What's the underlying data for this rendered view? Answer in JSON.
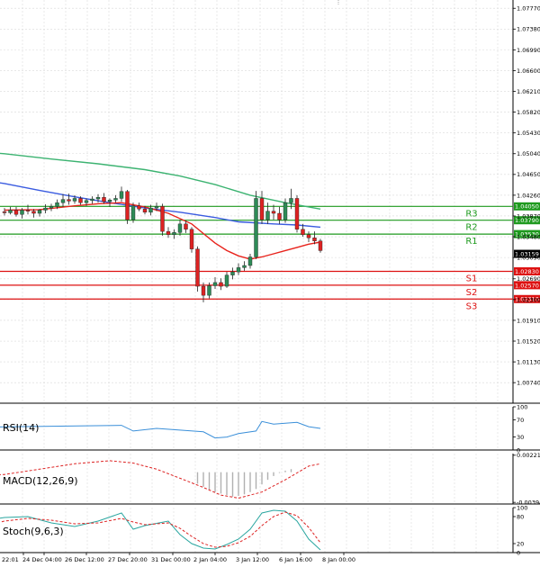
{
  "colors": {
    "bull": "#2e8b57",
    "bear": "#dd2222",
    "resistance": "#1e9a1e",
    "support": "#dd1111",
    "ma_fast": "#e8231c",
    "ma_mid": "#3b5ce0",
    "ma_slow": "#3cb371",
    "grid": "#d9d9d9",
    "rsi": "#3a8fd9",
    "macd_hist": "#b0b0b0",
    "macd_signal": "#dd2222",
    "stoch_k": "#2aa6a0",
    "stoch_d": "#dd2222"
  },
  "chart_data": [
    {
      "type": "candlestick",
      "panel": "price",
      "y_ticks": [
        "1.07770",
        "1.07380",
        "1.06990",
        "1.06600",
        "1.06210",
        "1.05820",
        "1.05430",
        "1.05040",
        "1.04650",
        "1.04260",
        "1.03870",
        "1.03480",
        "1.03090",
        "1.02690",
        "1.02300",
        "1.01910",
        "1.01520",
        "1.01130",
        "1.00740"
      ],
      "ylim": [
        1.00354,
        1.07926
      ],
      "x_labels": [
        "22:01",
        "24 Dec 04:00",
        "26 Dec 12:00",
        "27 Dec 20:00",
        "31 Dec 00:00",
        "2 Jan 04:00",
        "3 Jan 12:00",
        "6 Jan 16:00",
        "8 Jan 00:00"
      ],
      "candles": [
        [
          1.0395,
          1.0402,
          1.0388,
          1.0393
        ],
        [
          1.0393,
          1.0404,
          1.039,
          1.0398
        ],
        [
          1.0398,
          1.0404,
          1.0386,
          1.039
        ],
        [
          1.039,
          1.0402,
          1.0382,
          1.0398
        ],
        [
          1.0398,
          1.0408,
          1.039,
          1.0396
        ],
        [
          1.0396,
          1.04,
          1.0384,
          1.0392
        ],
        [
          1.0392,
          1.04,
          1.0386,
          1.0398
        ],
        [
          1.0398,
          1.0409,
          1.0392,
          1.0402
        ],
        [
          1.0402,
          1.041,
          1.0396,
          1.0405
        ],
        [
          1.0405,
          1.0418,
          1.04,
          1.0412
        ],
        [
          1.0412,
          1.0428,
          1.0404,
          1.0418
        ],
        [
          1.0418,
          1.0429,
          1.0408,
          1.0415
        ],
        [
          1.0415,
          1.0426,
          1.041,
          1.042
        ],
        [
          1.042,
          1.0424,
          1.0408,
          1.0412
        ],
        [
          1.0412,
          1.042,
          1.0406,
          1.0416
        ],
        [
          1.0416,
          1.0424,
          1.041,
          1.0419
        ],
        [
          1.0419,
          1.0428,
          1.0412,
          1.0422
        ],
        [
          1.0422,
          1.043,
          1.041,
          1.0414
        ],
        [
          1.0414,
          1.042,
          1.0404,
          1.0417
        ],
        [
          1.0417,
          1.0426,
          1.0412,
          1.042
        ],
        [
          1.042,
          1.0442,
          1.0414,
          1.0433
        ],
        [
          1.0433,
          1.0436,
          1.0372,
          1.038
        ],
        [
          1.038,
          1.0412,
          1.0374,
          1.0406
        ],
        [
          1.0406,
          1.0412,
          1.0396,
          1.04
        ],
        [
          1.04,
          1.0406,
          1.039,
          1.0394
        ],
        [
          1.0394,
          1.0408,
          1.0388,
          1.0402
        ],
        [
          1.0402,
          1.0412,
          1.0396,
          1.0405
        ],
        [
          1.0405,
          1.041,
          1.035,
          1.0358
        ],
        [
          1.0358,
          1.0366,
          1.0346,
          1.0352
        ],
        [
          1.0352,
          1.0362,
          1.0344,
          1.0356
        ],
        [
          1.0356,
          1.038,
          1.035,
          1.0372
        ],
        [
          1.0372,
          1.0378,
          1.0355,
          1.0362
        ],
        [
          1.0362,
          1.0366,
          1.0318,
          1.0325
        ],
        [
          1.0325,
          1.033,
          1.0245,
          1.0255
        ],
        [
          1.0255,
          1.0262,
          1.0225,
          1.0238
        ],
        [
          1.0238,
          1.0262,
          1.0232,
          1.0256
        ],
        [
          1.0256,
          1.0272,
          1.025,
          1.0262
        ],
        [
          1.0262,
          1.027,
          1.0248,
          1.0255
        ],
        [
          1.0255,
          1.0282,
          1.0252,
          1.0276
        ],
        [
          1.0276,
          1.029,
          1.0268,
          1.0282
        ],
        [
          1.0282,
          1.0298,
          1.0276,
          1.029
        ],
        [
          1.029,
          1.0302,
          1.0284,
          1.0294
        ],
        [
          1.0294,
          1.0316,
          1.0288,
          1.031
        ],
        [
          1.031,
          1.0434,
          1.0306,
          1.042
        ],
        [
          1.042,
          1.0434,
          1.0372,
          1.038
        ],
        [
          1.038,
          1.0412,
          1.0372,
          1.0396
        ],
        [
          1.0396,
          1.0408,
          1.038,
          1.0392
        ],
        [
          1.0392,
          1.0404,
          1.0372,
          1.038
        ],
        [
          1.038,
          1.042,
          1.0374,
          1.0412
        ],
        [
          1.0412,
          1.0438,
          1.04,
          1.042
        ],
        [
          1.042,
          1.0426,
          1.0356,
          1.0362
        ],
        [
          1.0362,
          1.0372,
          1.0348,
          1.0352
        ],
        [
          1.0352,
          1.0358,
          1.0338,
          1.0346
        ],
        [
          1.0346,
          1.0358,
          1.0334,
          1.034
        ],
        [
          1.034,
          1.0344,
          1.0318,
          1.0322
        ]
      ],
      "ma_fast": [
        [
          0,
          1.0398
        ],
        [
          6,
          1.0399
        ],
        [
          12,
          1.0406
        ],
        [
          16,
          1.041
        ],
        [
          20,
          1.0412
        ],
        [
          24,
          1.0404
        ],
        [
          28,
          1.0392
        ],
        [
          32,
          1.0372
        ],
        [
          34,
          1.0354
        ],
        [
          36,
          1.0336
        ],
        [
          38,
          1.0322
        ],
        [
          40,
          1.0312
        ],
        [
          42,
          1.0306
        ],
        [
          44,
          1.031
        ],
        [
          46,
          1.0316
        ],
        [
          48,
          1.0322
        ],
        [
          50,
          1.0328
        ],
        [
          52,
          1.0334
        ],
        [
          54,
          1.0338
        ]
      ],
      "ma_mid": [
        [
          -8,
          1.046
        ],
        [
          0,
          1.0448
        ],
        [
          6,
          1.0435
        ],
        [
          12,
          1.0423
        ],
        [
          18,
          1.0412
        ],
        [
          24,
          1.0402
        ],
        [
          30,
          1.0394
        ],
        [
          36,
          1.0384
        ],
        [
          40,
          1.0376
        ],
        [
          46,
          1.0372
        ],
        [
          50,
          1.037
        ],
        [
          54,
          1.0366
        ]
      ],
      "ma_slow": [
        [
          -8,
          1.051
        ],
        [
          0,
          1.0504
        ],
        [
          8,
          1.0494
        ],
        [
          16,
          1.0485
        ],
        [
          24,
          1.0474
        ],
        [
          30,
          1.0462
        ],
        [
          36,
          1.0446
        ],
        [
          42,
          1.0426
        ],
        [
          48,
          1.0412
        ],
        [
          54,
          1.04
        ]
      ],
      "levels": [
        {
          "name": "R3",
          "value": 1.0405,
          "label": "1.04050",
          "kind": "resistance"
        },
        {
          "name": "R2",
          "value": 1.0379,
          "label": "1.03790",
          "kind": "resistance"
        },
        {
          "name": "R1",
          "value": 1.0353,
          "label": "1.03530",
          "kind": "resistance"
        },
        {
          "name": "S1",
          "value": 1.0283,
          "label": "1.02830",
          "kind": "support"
        },
        {
          "name": "S2",
          "value": 1.0257,
          "label": "1.02570",
          "kind": "support"
        },
        {
          "name": "S3",
          "value": 1.0231,
          "label": "1.02310",
          "kind": "support"
        }
      ],
      "current_price": {
        "value": 1.03159,
        "label": "1.03159"
      }
    },
    {
      "type": "line",
      "panel": "rsi",
      "title": "RSI(14)",
      "y_ticks": [
        "100",
        "70",
        "30",
        "0"
      ],
      "ylim": [
        0,
        100
      ],
      "values": [
        [
          -8,
          52
        ],
        [
          2,
          54
        ],
        [
          8,
          55
        ],
        [
          14,
          56
        ],
        [
          20,
          57
        ],
        [
          22,
          44
        ],
        [
          26,
          50
        ],
        [
          30,
          46
        ],
        [
          34,
          42
        ],
        [
          36,
          28
        ],
        [
          38,
          30
        ],
        [
          40,
          38
        ],
        [
          43,
          44
        ],
        [
          44,
          66
        ],
        [
          46,
          60
        ],
        [
          48,
          62
        ],
        [
          50,
          64
        ],
        [
          52,
          54
        ],
        [
          54,
          50
        ]
      ]
    },
    {
      "type": "bar+line",
      "panel": "macd",
      "title": "MACD(12,26,9)",
      "y_ticks": [
        "0.002217",
        "-0.003945"
      ],
      "ylim": [
        -0.00416,
        0.00243
      ],
      "signal": [
        [
          -8,
          -0.0005
        ],
        [
          0,
          -0.0003
        ],
        [
          6,
          0.0004
        ],
        [
          12,
          0.0011
        ],
        [
          18,
          0.0015
        ],
        [
          22,
          0.0012
        ],
        [
          26,
          0.0004
        ],
        [
          30,
          -0.0008
        ],
        [
          34,
          -0.002
        ],
        [
          37,
          -0.003
        ],
        [
          40,
          -0.0034
        ],
        [
          44,
          -0.0026
        ],
        [
          48,
          -0.001
        ],
        [
          52,
          0.0008
        ],
        [
          54,
          0.0011
        ]
      ],
      "histogram": [
        [
          33,
          -0.0015
        ],
        [
          34,
          -0.0019
        ],
        [
          35,
          -0.0023
        ],
        [
          36,
          -0.0026
        ],
        [
          37,
          -0.0028
        ],
        [
          38,
          -0.003
        ],
        [
          39,
          -0.0032
        ],
        [
          40,
          -0.0031
        ],
        [
          41,
          -0.0029
        ],
        [
          42,
          -0.0026
        ],
        [
          43,
          -0.0022
        ],
        [
          44,
          -0.0016
        ],
        [
          45,
          -0.001
        ],
        [
          46,
          -0.0005
        ],
        [
          47,
          -0.0001
        ],
        [
          48,
          0.0002
        ],
        [
          49,
          0.0004
        ]
      ]
    },
    {
      "type": "line",
      "panel": "stoch",
      "title": "Stoch(9,6,3)",
      "y_ticks": [
        "100",
        "80",
        "20",
        "0"
      ],
      "ylim": [
        0,
        100
      ],
      "k": [
        [
          -8,
          55
        ],
        [
          -4,
          70
        ],
        [
          0,
          78
        ],
        [
          4,
          80
        ],
        [
          8,
          66
        ],
        [
          12,
          58
        ],
        [
          16,
          70
        ],
        [
          20,
          88
        ],
        [
          22,
          52
        ],
        [
          24,
          60
        ],
        [
          28,
          70
        ],
        [
          30,
          40
        ],
        [
          32,
          20
        ],
        [
          34,
          10
        ],
        [
          36,
          8
        ],
        [
          38,
          18
        ],
        [
          40,
          30
        ],
        [
          42,
          52
        ],
        [
          44,
          88
        ],
        [
          46,
          94
        ],
        [
          48,
          92
        ],
        [
          50,
          70
        ],
        [
          52,
          30
        ],
        [
          54,
          6
        ]
      ],
      "d": [
        [
          -8,
          48
        ],
        [
          -4,
          58
        ],
        [
          0,
          70
        ],
        [
          4,
          76
        ],
        [
          8,
          72
        ],
        [
          12,
          64
        ],
        [
          16,
          66
        ],
        [
          20,
          76
        ],
        [
          22,
          68
        ],
        [
          24,
          62
        ],
        [
          28,
          66
        ],
        [
          30,
          54
        ],
        [
          32,
          36
        ],
        [
          34,
          20
        ],
        [
          36,
          12
        ],
        [
          38,
          14
        ],
        [
          40,
          22
        ],
        [
          42,
          36
        ],
        [
          44,
          60
        ],
        [
          46,
          80
        ],
        [
          48,
          90
        ],
        [
          50,
          82
        ],
        [
          52,
          56
        ],
        [
          54,
          22
        ]
      ]
    }
  ]
}
